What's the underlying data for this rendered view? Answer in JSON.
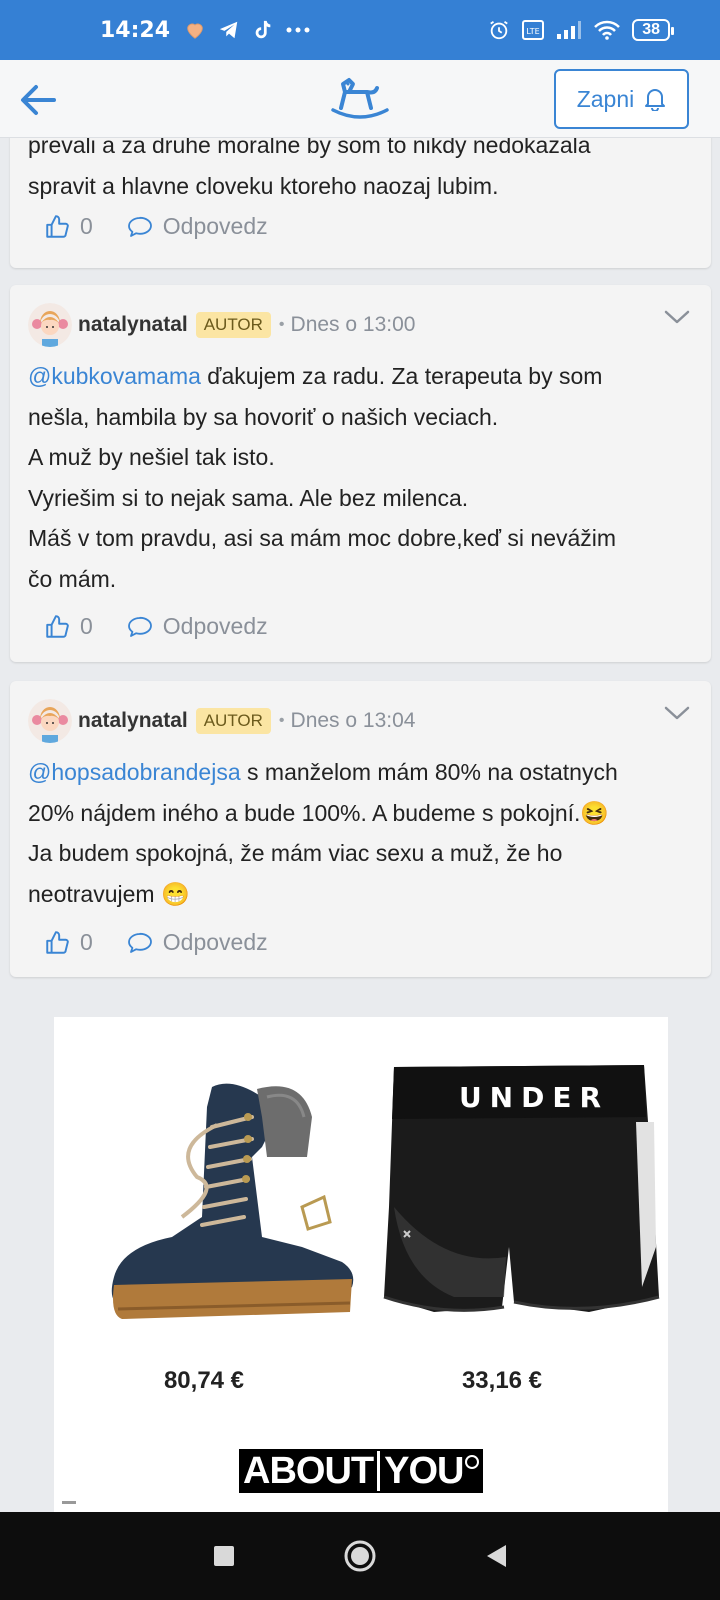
{
  "status_bar": {
    "time": "14:24",
    "battery": "38",
    "left_icons": [
      "heart-icon",
      "telegram-icon",
      "tiktok-icon",
      "more-icon"
    ],
    "right_icons": [
      "alarm-icon",
      "volte-icon",
      "signal-icon",
      "wifi-icon",
      "battery-icon"
    ]
  },
  "header": {
    "notify_label": "Zapni",
    "colors": {
      "accent": "#3a85d4",
      "status_bar": "#3580d4"
    }
  },
  "comments": [
    {
      "partial": true,
      "lines": [
        "prevali a za druhe moralne by som to nikdy nedokazala",
        "spravit a hlavne cloveku ktoreho naozaj lubim."
      ],
      "likes": "0",
      "reply_label": "Odpovedz"
    },
    {
      "user": "natalynatal",
      "badge": "AUTOR",
      "time": "Dnes o 13:00",
      "mention": "@kubkovamama",
      "first_line_rest": " ďakujem za radu. Za terapeuta by som",
      "lines": [
        "nešla, hambila by sa hovoriť o našich veciach.",
        "A muž by nešiel tak isto.",
        "Vyriešim si to nejak sama. Ale bez milenca.",
        "Máš v tom pravdu, asi sa mám moc dobre,keď si nevážim",
        "čo mám."
      ],
      "likes": "0",
      "reply_label": "Odpovedz"
    },
    {
      "user": "natalynatal",
      "badge": "AUTOR",
      "time": "Dnes o 13:04",
      "mention": "@hopsadobrandejsa",
      "first_line_rest": " s manželom mám 80% na ostatnych",
      "lines": [
        "20% nájdem iného a bude 100%. A budeme s pokojní.😆",
        "Ja budem spokojná, že mám viac sexu a muž, že ho",
        "neotravujem 😁"
      ],
      "likes": "0",
      "reply_label": "Odpovedz"
    }
  ],
  "ad": {
    "products": [
      {
        "name": "boot",
        "price": "80,74 €"
      },
      {
        "name": "shorts",
        "price": "33,16 €",
        "print": "UNDER"
      }
    ],
    "brand_left": "ABOUT",
    "brand_right": "YOU"
  },
  "nav": [
    "recents-button",
    "home-button",
    "back-button"
  ]
}
